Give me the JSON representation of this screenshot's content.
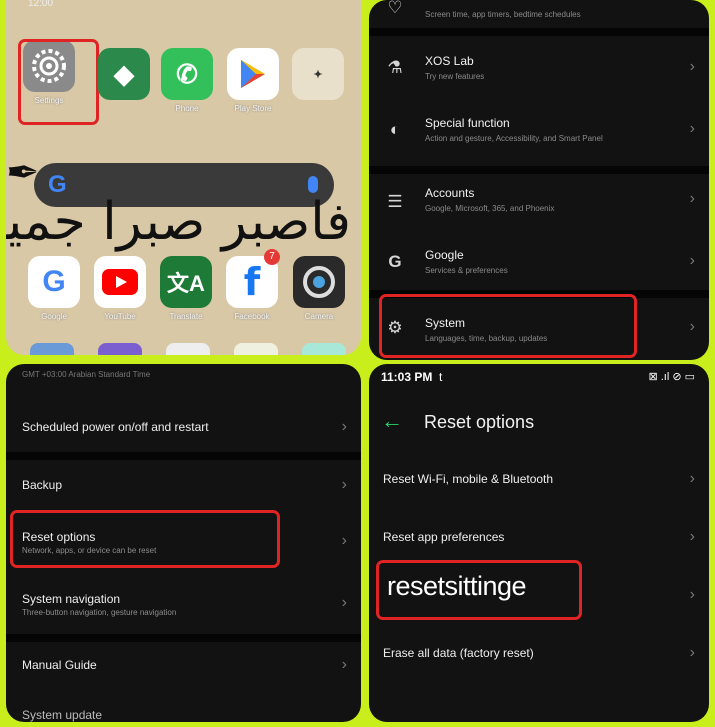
{
  "home": {
    "status_text": "12:00",
    "apps_row1": [
      "Settings",
      "",
      "Phone",
      "Play Store",
      ""
    ],
    "apps_row2": [
      "Google",
      "YouTube",
      "Translate",
      "Facebook",
      "Camera"
    ],
    "facebook_badge": "7",
    "calligraphy": "فاصبر صبرا جميلا"
  },
  "settings": {
    "items": [
      {
        "sub": "Screen time, app timers, bedtime schedules"
      },
      {
        "title": "XOS Lab",
        "sub": "Try new features"
      },
      {
        "title": "Special function",
        "sub": "Action and gesture, Accessibility, and Smart Panel"
      },
      {
        "title": "Accounts",
        "sub": "Google, Microsoft, 365, and Phoenix"
      },
      {
        "title": "Google",
        "sub": "Services & preferences"
      },
      {
        "title": "System",
        "sub": "Languages, time, backup, updates"
      }
    ]
  },
  "system": {
    "top_text": "GMT +03:00 Arabian Standard Time",
    "items": [
      {
        "title": "Scheduled power on/off and restart"
      },
      {
        "title": "Backup"
      },
      {
        "title": "Reset options",
        "sub": "Network, apps, or device can be reset"
      },
      {
        "title": "System navigation",
        "sub": "Three-button navigation, gesture navigation"
      },
      {
        "title": "Manual Guide"
      },
      {
        "title": "System update"
      }
    ]
  },
  "reset": {
    "time": "11:03 PM",
    "carrier": "t",
    "status_icons": "⊠ .ıl ⊘ ▭",
    "page_title": "Reset options",
    "items": [
      {
        "title": "Reset Wi-Fi, mobile & Bluetooth"
      },
      {
        "title": "Reset app preferences"
      },
      {
        "title": "Erase all data (factory reset)"
      }
    ],
    "overlay_text": "resetsittinge"
  },
  "chevron": "›",
  "back_arrow": "←",
  "accent_green": "#27d36b",
  "highlight_red": "#e02424"
}
